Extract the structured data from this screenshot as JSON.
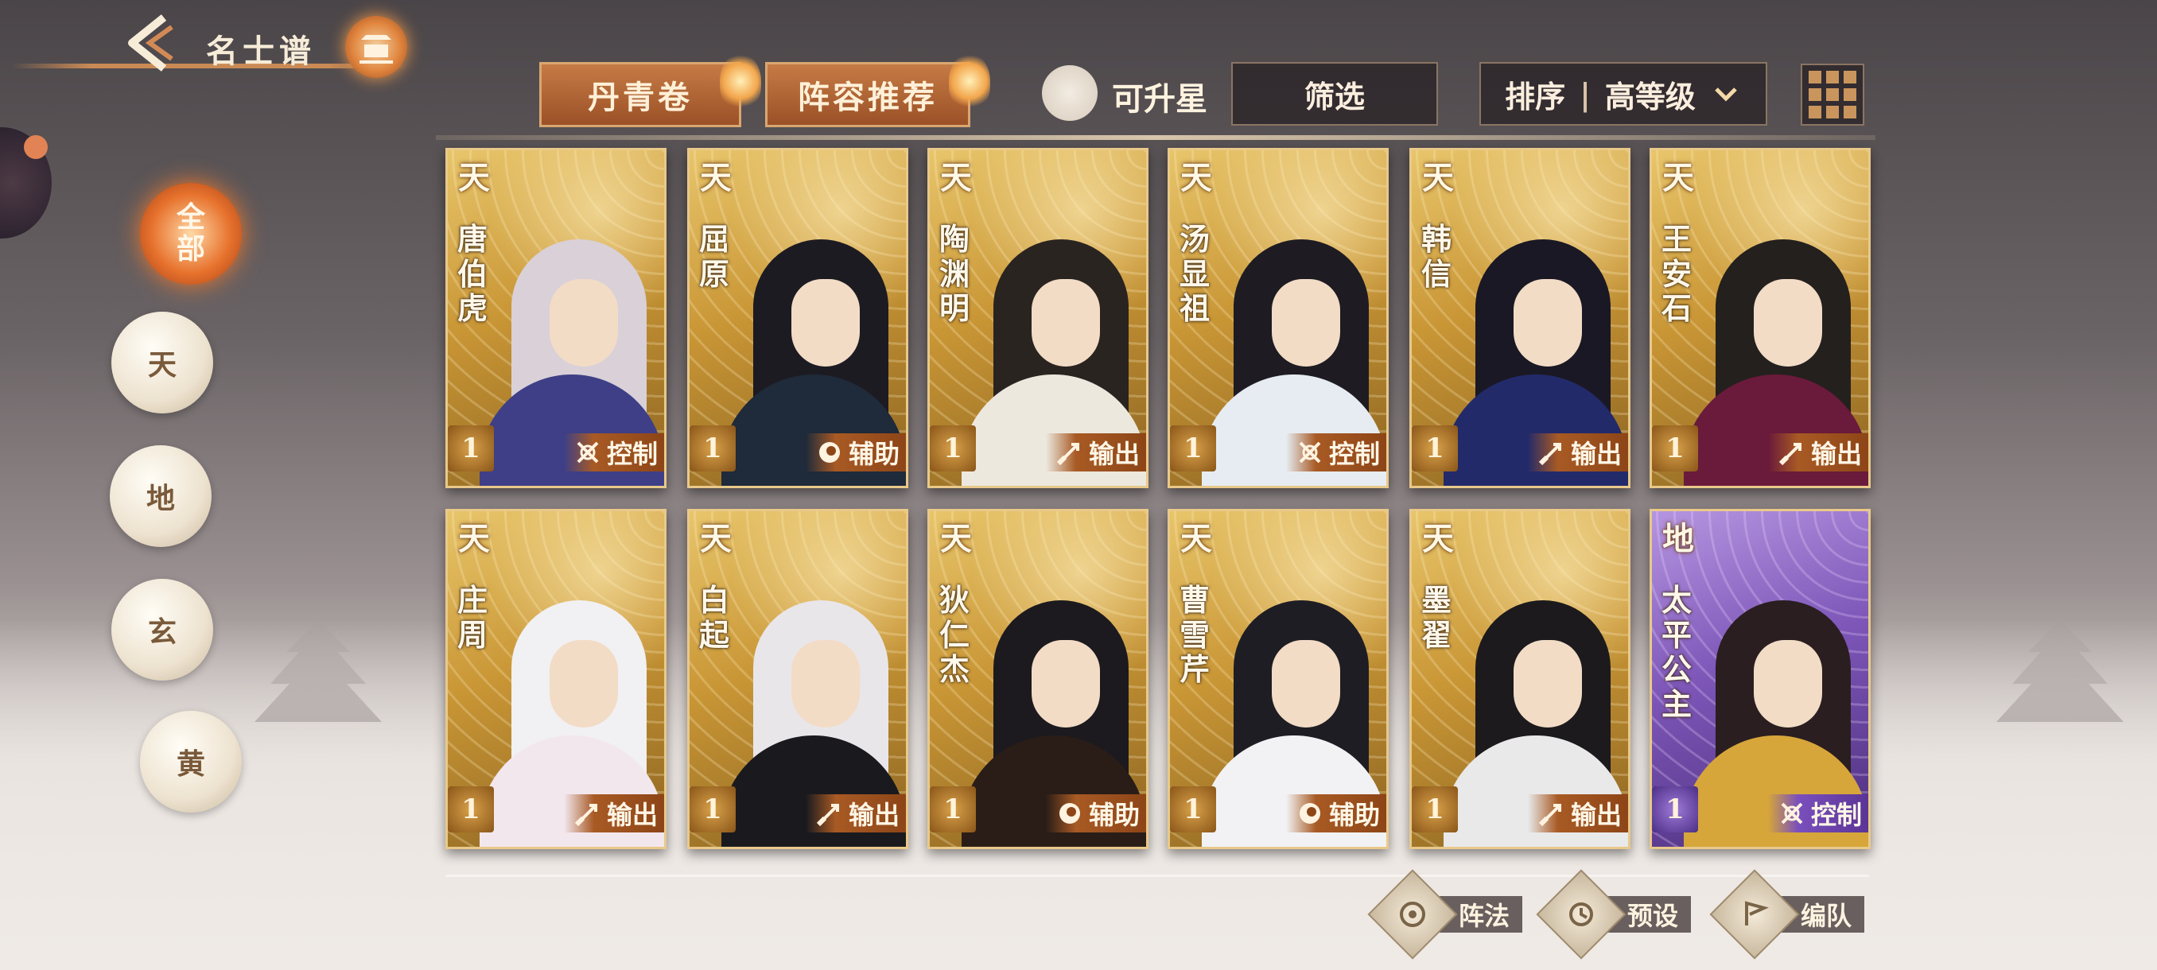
{
  "header": {
    "title": "名士谱",
    "back_icon": "back-arrow-icon",
    "emblem_icon": "pagoda-emblem-icon"
  },
  "toolbar": {
    "tab_danqing": "丹青卷",
    "tab_lineup": "阵容推荐",
    "toggle_upgradable": "可升星",
    "filter_label": "筛选",
    "sort_label": "排序",
    "sort_value": "高等级",
    "grid_icon": "grid-view-icon"
  },
  "rank_filters": [
    {
      "label": "全部",
      "active": true
    },
    {
      "label": "天",
      "active": false
    },
    {
      "label": "地",
      "active": false
    },
    {
      "label": "玄",
      "active": false
    },
    {
      "label": "黄",
      "active": false
    }
  ],
  "cards": [
    {
      "rank": "天",
      "name": "唐伯虎",
      "stars": "1",
      "role": "控制",
      "role_icon": "control-icon",
      "tier": "gold"
    },
    {
      "rank": "天",
      "name": "屈原",
      "stars": "1",
      "role": "辅助",
      "role_icon": "support-icon",
      "tier": "gold"
    },
    {
      "rank": "天",
      "name": "陶渊明",
      "stars": "1",
      "role": "输出",
      "role_icon": "damage-icon",
      "tier": "gold"
    },
    {
      "rank": "天",
      "name": "汤显祖",
      "stars": "1",
      "role": "控制",
      "role_icon": "control-icon",
      "tier": "gold"
    },
    {
      "rank": "天",
      "name": "韩信",
      "stars": "1",
      "role": "输出",
      "role_icon": "damage-icon",
      "tier": "gold"
    },
    {
      "rank": "天",
      "name": "王安石",
      "stars": "1",
      "role": "输出",
      "role_icon": "damage-icon",
      "tier": "gold"
    },
    {
      "rank": "天",
      "name": "庄周",
      "stars": "1",
      "role": "输出",
      "role_icon": "damage-icon",
      "tier": "gold"
    },
    {
      "rank": "天",
      "name": "白起",
      "stars": "1",
      "role": "输出",
      "role_icon": "damage-icon",
      "tier": "gold"
    },
    {
      "rank": "天",
      "name": "狄仁杰",
      "stars": "1",
      "role": "辅助",
      "role_icon": "support-icon",
      "tier": "gold"
    },
    {
      "rank": "天",
      "name": "曹雪芹",
      "stars": "1",
      "role": "辅助",
      "role_icon": "support-icon",
      "tier": "gold"
    },
    {
      "rank": "天",
      "name": "墨翟",
      "stars": "1",
      "role": "输出",
      "role_icon": "damage-icon",
      "tier": "gold"
    },
    {
      "rank": "地",
      "name": "太平公主",
      "stars": "1",
      "role": "控制",
      "role_icon": "control-icon",
      "tier": "purple"
    }
  ],
  "bottom_actions": [
    {
      "label": "阵法",
      "icon": "formation-icon"
    },
    {
      "label": "预设",
      "icon": "preset-icon"
    },
    {
      "label": "编队",
      "icon": "team-flag-icon"
    }
  ],
  "colors": {
    "gold_card": "#c99635",
    "purple_card": "#7d56b8",
    "accent_orange": "#e7722d"
  }
}
